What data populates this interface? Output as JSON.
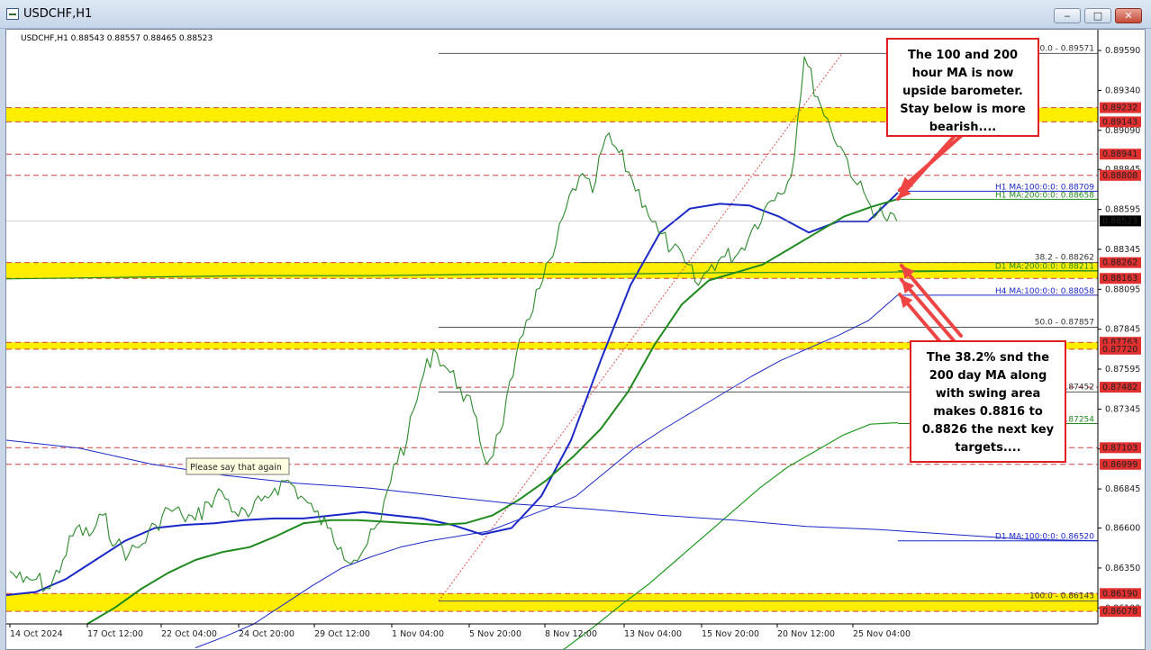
{
  "window": {
    "title": "USDCHF,H1",
    "minimize_glyph": "‒",
    "maximize_glyph": "□",
    "close_glyph": "✕"
  },
  "colors": {
    "ma100_h1": "#1a28c8",
    "ma200_h1": "#1e8a1e",
    "ma200_d1": "#1e8a1e",
    "ma100_h4": "#1a28c8",
    "ma100_d1": "#1a28c8",
    "ma_thin_green": "#1e9a1e",
    "zone": "#ffee00",
    "bid_line": "#e05050",
    "annotation_border": "#e02020",
    "arrow": "#ee4444"
  },
  "chart_data": {
    "type": "line",
    "symbol_info": "USDCHF,H1  0.88543 0.88557 0.88465 0.88523",
    "ylim": [
      0.86,
      0.8972
    ],
    "y_ticks": [
      "0.89590",
      "0.89340",
      "0.89090",
      "0.88845",
      "0.88595",
      "0.88345",
      "0.88095",
      "0.87845",
      "0.87595",
      "0.87345",
      "0.87095",
      "0.86845",
      "0.86600",
      "0.86350",
      "0.86100"
    ],
    "x_ticks": [
      "14 Oct 2024",
      "17 Oct 12:00",
      "22 Oct 04:00",
      "24 Oct 20:00",
      "29 Oct 12:00",
      "1 Nov 04:00",
      "5 Nov 20:00",
      "8 Nov 12:00",
      "13 Nov 04:00",
      "15 Nov 20:00",
      "20 Nov 12:00",
      "25 Nov 04:00"
    ],
    "current_price": "0.88523",
    "zones": [
      {
        "from": 0.89143,
        "to": 0.89232
      },
      {
        "from": 0.88163,
        "to": 0.88262
      },
      {
        "from": 0.8772,
        "to": 0.87763
      },
      {
        "from": 0.86078,
        "to": 0.8619
      }
    ],
    "price_levels": [
      {
        "value": 0.89232,
        "label": "0.89232",
        "style": "zone"
      },
      {
        "value": 0.89143,
        "label": "0.89143",
        "style": "zone"
      },
      {
        "value": 0.88941,
        "label": "0.88941",
        "style": "dash"
      },
      {
        "value": 0.88808,
        "label": "0.88808",
        "style": "dash"
      },
      {
        "value": 0.88262,
        "label": "0.88262",
        "style": "zone"
      },
      {
        "value": 0.88163,
        "label": "0.88163",
        "style": "zone"
      },
      {
        "value": 0.87763,
        "label": "0.87763",
        "style": "zone"
      },
      {
        "value": 0.8772,
        "label": "0.87720",
        "style": "zone"
      },
      {
        "value": 0.87482,
        "label": "0.87482",
        "style": "dash"
      },
      {
        "value": 0.87103,
        "label": "0.87103",
        "style": "dash"
      },
      {
        "value": 0.86999,
        "label": "0.86999",
        "style": "dash"
      },
      {
        "value": 0.8619,
        "label": "0.86190",
        "style": "zone"
      },
      {
        "value": 0.86078,
        "label": "0.86078",
        "style": "zone"
      }
    ],
    "fib_levels": [
      {
        "value": 0.89571,
        "label": "0.0 - 0.89571"
      },
      {
        "value": 0.88262,
        "label": "38.2 - 0.88262"
      },
      {
        "value": 0.87857,
        "label": "50.0 - 0.87857"
      },
      {
        "value": 0.87452,
        "label": "0.87452"
      },
      {
        "value": 0.86143,
        "label": "100.0 - 0.86143"
      }
    ],
    "ma_labels": [
      {
        "value": 0.88709,
        "label": "H1 MA:100:0:0: 0.88709",
        "color": "#1a28c8"
      },
      {
        "value": 0.88658,
        "label": "H1 MA:200:0:0: 0.88658",
        "color": "#1e8a1e"
      },
      {
        "value": 0.88211,
        "label": "D1 MA:200:0:0: 0.88211",
        "color": "#1e8a1e"
      },
      {
        "value": 0.88058,
        "label": "H4 MA:100:0:0: 0.88058",
        "color": "#1a28c8"
      },
      {
        "value": 0.87254,
        "label": "0.87254",
        "color": "#1e8a1e"
      },
      {
        "value": 0.8652,
        "label": "D1 MA:100:0:0: 0.86520",
        "color": "#1a28c8"
      }
    ],
    "price_path": [
      [
        0,
        0.8633
      ],
      [
        1,
        0.8626
      ],
      [
        2,
        0.8628
      ],
      [
        3,
        0.8622
      ],
      [
        4,
        0.864
      ],
      [
        5,
        0.866
      ],
      [
        6,
        0.8655
      ],
      [
        7,
        0.8668
      ],
      [
        8,
        0.865
      ],
      [
        9,
        0.8644
      ],
      [
        10,
        0.865
      ],
      [
        11,
        0.8662
      ],
      [
        12,
        0.8672
      ],
      [
        13,
        0.8668
      ],
      [
        14,
        0.8665
      ],
      [
        15,
        0.8676
      ],
      [
        16,
        0.8683
      ],
      [
        17,
        0.867
      ],
      [
        18,
        0.8667
      ],
      [
        19,
        0.8677
      ],
      [
        20,
        0.8685
      ],
      [
        21,
        0.869
      ],
      [
        22,
        0.868
      ],
      [
        23,
        0.867
      ],
      [
        24,
        0.866
      ],
      [
        25,
        0.8648
      ],
      [
        26,
        0.864
      ],
      [
        27,
        0.865
      ],
      [
        28,
        0.8664
      ],
      [
        29,
        0.87
      ],
      [
        30,
        0.8715
      ],
      [
        31,
        0.875
      ],
      [
        32,
        0.8772
      ],
      [
        33,
        0.876
      ],
      [
        34,
        0.8748
      ],
      [
        35,
        0.8733
      ],
      [
        36,
        0.87
      ],
      [
        37,
        0.872
      ],
      [
        38,
        0.8755
      ],
      [
        39,
        0.879
      ],
      [
        40,
        0.881
      ],
      [
        41,
        0.883
      ],
      [
        42,
        0.886
      ],
      [
        43,
        0.888
      ],
      [
        44,
        0.887
      ],
      [
        45,
        0.8905
      ],
      [
        46,
        0.8895
      ],
      [
        47,
        0.8878
      ],
      [
        48,
        0.8862
      ],
      [
        49,
        0.8845
      ],
      [
        50,
        0.8835
      ],
      [
        51,
        0.8826
      ],
      [
        52,
        0.8812
      ],
      [
        53,
        0.8825
      ],
      [
        54,
        0.883
      ],
      [
        55,
        0.8832
      ],
      [
        56,
        0.8846
      ],
      [
        57,
        0.886
      ],
      [
        58,
        0.887
      ],
      [
        59,
        0.888
      ],
      [
        60,
        0.8955
      ],
      [
        61,
        0.893
      ],
      [
        62,
        0.891
      ],
      [
        63,
        0.8895
      ],
      [
        64,
        0.8875
      ],
      [
        65,
        0.8862
      ],
      [
        66,
        0.8855
      ],
      [
        67,
        0.8852
      ]
    ],
    "ma_series": [
      {
        "kind": "h1_ma100",
        "values": [
          0.8618,
          0.862,
          0.8628,
          0.864,
          0.8652,
          0.866,
          0.8662,
          0.8663,
          0.8665,
          0.8666,
          0.8666,
          0.8668,
          0.867,
          0.8668,
          0.8666,
          0.8662,
          0.8656,
          0.866,
          0.868,
          0.8715,
          0.8765,
          0.8812,
          0.8845,
          0.886,
          0.8863,
          0.8862,
          0.8855,
          0.8845,
          0.8852,
          0.8852,
          0.887
        ]
      },
      {
        "kind": "h1_ma200",
        "values": [
          0.86,
          0.861,
          0.8622,
          0.8632,
          0.864,
          0.8645,
          0.8648,
          0.8655,
          0.8663,
          0.8665,
          0.8665,
          0.8664,
          0.8663,
          0.8662,
          0.8663,
          0.8668,
          0.8678,
          0.869,
          0.8705,
          0.8722,
          0.8745,
          0.8775,
          0.88,
          0.8815,
          0.882,
          0.8825,
          0.8835,
          0.8845,
          0.8855,
          0.8861,
          0.8866
        ]
      },
      {
        "kind": "h4_ma100",
        "values": [
          0.8585,
          0.8592,
          0.86,
          0.8612,
          0.8624,
          0.8635,
          0.8642,
          0.8648,
          0.8652,
          0.8655,
          0.8658,
          0.8665,
          0.8672,
          0.868,
          0.8695,
          0.871,
          0.8722,
          0.8733,
          0.8744,
          0.8755,
          0.8765,
          0.8773,
          0.8781,
          0.879,
          0.8806
        ]
      },
      {
        "kind": "green_thin",
        "values": [
          0.8565,
          0.8575,
          0.8585,
          0.8598,
          0.8612,
          0.8625,
          0.864,
          0.8655,
          0.867,
          0.8685,
          0.8698,
          0.8708,
          0.8718,
          0.8725,
          0.8726
        ]
      },
      {
        "kind": "d1_ma100",
        "values": [
          0.8715,
          0.871,
          0.87,
          0.8693,
          0.8688,
          0.8685,
          0.868,
          0.8675,
          0.8672,
          0.8668,
          0.8665,
          0.8661,
          0.8659,
          0.8656,
          0.8653,
          0.8652
        ]
      },
      {
        "kind": "d1_ma200",
        "values": [
          0.8816,
          0.8817,
          0.8818,
          0.8818,
          0.8819,
          0.8819,
          0.882,
          0.882,
          0.8821,
          0.8821
        ]
      }
    ]
  },
  "annotations": {
    "top_box": [
      "The 100 and 200",
      "hour MA is now",
      "upside barometer.",
      "Stay below is more",
      "bearish...."
    ],
    "bottom_box": [
      "The 38.2% snd the",
      "200 day MA along",
      "with swing area",
      "makes 0.8816 to",
      "0.8826 the next key",
      "targets...."
    ],
    "tooltip": "Please say that again"
  }
}
